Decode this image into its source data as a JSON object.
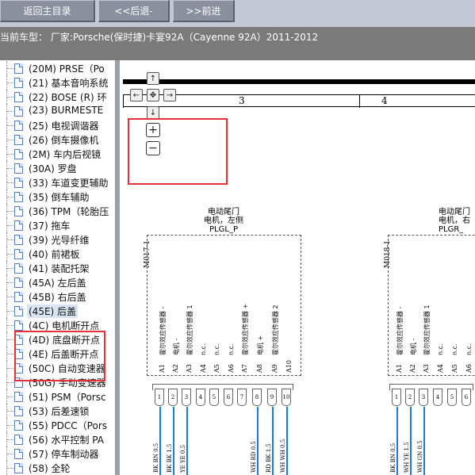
{
  "toolbar": {
    "home_label": "返回主目录",
    "back_label": "<<后退-",
    "forward_label": ">>前进"
  },
  "info": {
    "text": "当前车型：  厂家:Porsche(保时捷)卡宴92A（Cayenne 92A）2011-2012"
  },
  "sidebar": {
    "items": [
      {
        "label": "(20M) PRSE（Po"
      },
      {
        "label": "(21) 基本音响系统"
      },
      {
        "label": "(22) BOSE (R) 环"
      },
      {
        "label": "(23) BURMESTE"
      },
      {
        "label": "(25) 电视调谐器"
      },
      {
        "label": "(26) 倒车摄像机"
      },
      {
        "label": "(2M) 车内后视镜"
      },
      {
        "label": "(30A) 罗盘"
      },
      {
        "label": "(33) 车道变更辅助"
      },
      {
        "label": "(35) 倒车辅助"
      },
      {
        "label": "(36) TPM（轮胎压"
      },
      {
        "label": "(37) 拖车"
      },
      {
        "label": "(39) 光导纤维"
      },
      {
        "label": "(40) 前裙板"
      },
      {
        "label": "(41) 装配托架"
      },
      {
        "label": "(45A) 左后盖"
      },
      {
        "label": "(45B) 右后盖"
      },
      {
        "label": "(45E) 后盖"
      },
      {
        "label": "(4C) 电机断开点"
      },
      {
        "label": "(4D) 底盘断开点"
      },
      {
        "label": "(4E) 后盖断开点"
      },
      {
        "label": "(50C) 自动变速器"
      },
      {
        "label": "(50G) 手动变速器"
      },
      {
        "label": "(51) PSM（Porsc"
      },
      {
        "label": "(53) 后差速锁"
      },
      {
        "label": "(55) PDCC（Pors"
      },
      {
        "label": "(56) 水平控制 PA"
      },
      {
        "label": "(57) 停车制动器"
      },
      {
        "label": "(58) 全轮"
      }
    ],
    "selected_index": 17
  },
  "diagram": {
    "nav": {
      "up": "↑",
      "down": "↓",
      "left": "←",
      "right": "→",
      "center": "✥",
      "zoom_in": "+",
      "zoom_out": "−"
    },
    "ruler": [
      "3",
      "4"
    ],
    "component_left": {
      "title_line1": "电动尾门",
      "title_line2": "电机，左侧",
      "title_line3": "PLGL_P",
      "id": "M017-1",
      "signals": [
        "霍尔效应传感器 -",
        "电机 -",
        "霍尔效应传感器 1",
        "n.c.",
        "n.c.",
        "n.c.",
        "霍尔效应传感器 +",
        "电机 +",
        "霍尔效应传感器 2"
      ],
      "pins": [
        "A1",
        "A2",
        "A3",
        "A4",
        "A5",
        "A6",
        "A7",
        "A8",
        "A9",
        "A10"
      ],
      "conn_pins": [
        "1",
        "2",
        "3",
        "4",
        "5",
        "6",
        "7",
        "8",
        "9",
        "10"
      ],
      "wires": [
        "BK BN 0.5",
        "BK BK 1.5",
        "YE YE 0.5",
        "WH RD 0.5",
        "RD BK 1.5",
        "WH WH 0.5"
      ]
    },
    "component_right": {
      "title_line1": "电动尾门",
      "title_line2": "电机，右",
      "title_line3": "PLGR_",
      "id": "M018-1",
      "signals": [
        "霍尔效应传感器 -",
        "电机 -",
        "霍尔效应传感器 1",
        "n.c.",
        "n.c.",
        "n.c."
      ],
      "pins": [
        "A1",
        "A2",
        "A3",
        "A4",
        "A5",
        "A6"
      ],
      "conn_pins": [
        "1",
        "2",
        "3",
        "4",
        "5",
        "6"
      ],
      "wires": [
        "BK BN 0.5",
        "WH YE 1.5",
        "WH GN 0.5"
      ]
    }
  },
  "colors": {
    "toolbar_bg": "#c4c8d4",
    "button_bg": "#8a909e",
    "infobar_bg": "#7a7a7a",
    "highlight": "#e8303a",
    "wire": "#1e7ad8"
  }
}
